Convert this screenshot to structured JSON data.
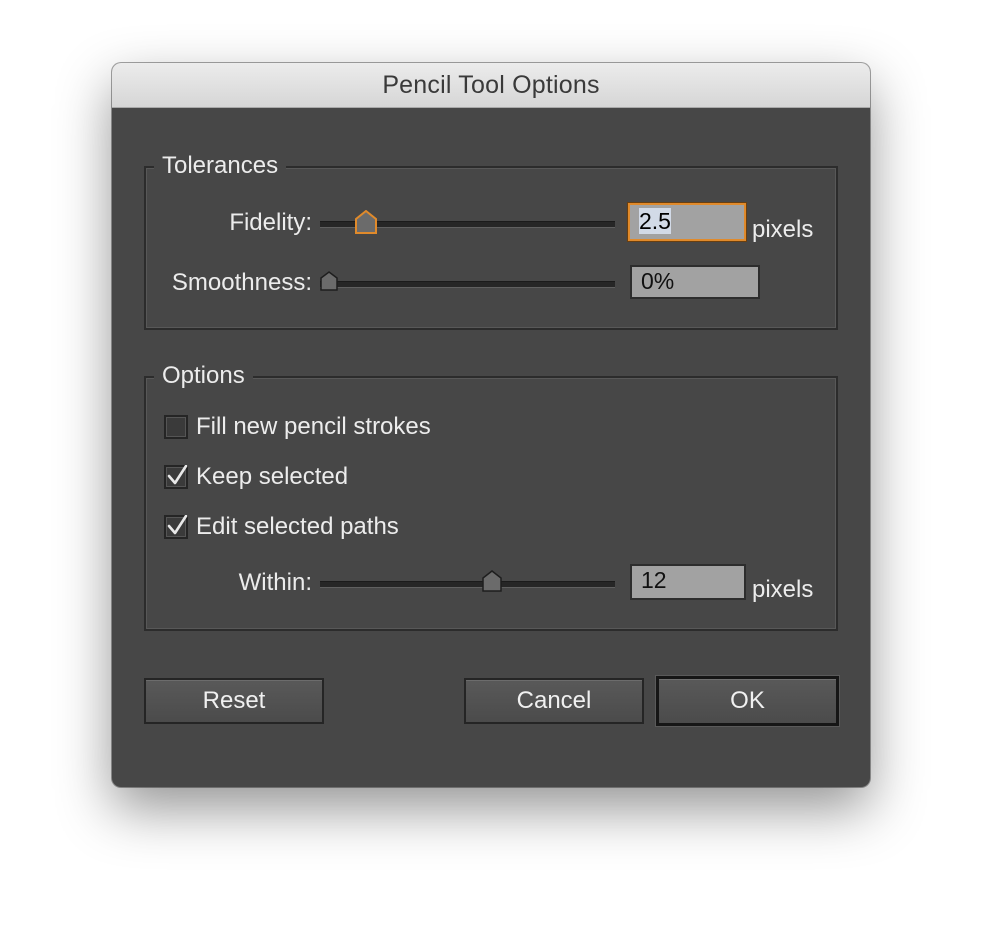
{
  "dialog": {
    "title": "Pencil Tool Options"
  },
  "tolerances": {
    "legend": "Tolerances",
    "fidelity": {
      "label": "Fidelity:",
      "value": "2.5",
      "unit": "pixels",
      "slider_fraction": 0.12
    },
    "smoothness": {
      "label": "Smoothness:",
      "value": "0%",
      "slider_fraction": 0.0
    }
  },
  "options": {
    "legend": "Options",
    "fill_new": {
      "label": "Fill new pencil strokes",
      "checked": false
    },
    "keep_selected": {
      "label": "Keep selected",
      "checked": true
    },
    "edit_selected": {
      "label": "Edit selected paths",
      "checked": true
    },
    "within": {
      "label": "Within:",
      "value": "12",
      "unit": "pixels",
      "slider_fraction": 0.55
    }
  },
  "buttons": {
    "reset": "Reset",
    "cancel": "Cancel",
    "ok": "OK"
  },
  "colors": {
    "dialog_bg": "#474747",
    "focus_accent": "#e08a2b",
    "field_bg": "#a2a2a2"
  },
  "icons": {
    "slider_thumb": "pentagon-slider-thumb-icon",
    "check": "checkmark-icon"
  }
}
